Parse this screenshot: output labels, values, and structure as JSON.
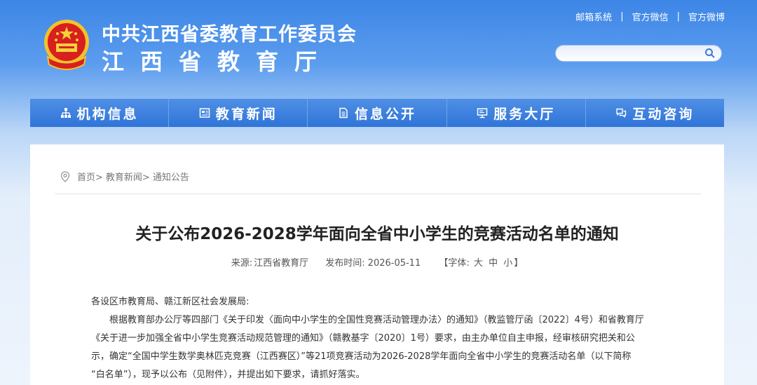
{
  "header": {
    "title_line1": "中共江西省委教育工作委员会",
    "title_line2": "江西省教育厅",
    "top_links": [
      "邮箱系统",
      "官方微信",
      "官方微博"
    ],
    "top_link_separator": "|",
    "search": {
      "placeholder": "",
      "value": ""
    }
  },
  "nav": {
    "items": [
      {
        "label": "机构信息",
        "icon": "org-chart-icon"
      },
      {
        "label": "教育新闻",
        "icon": "news-icon"
      },
      {
        "label": "信息公开",
        "icon": "document-icon"
      },
      {
        "label": "服务大厅",
        "icon": "monitor-icon"
      },
      {
        "label": "互动咨询",
        "icon": "chat-icon"
      }
    ]
  },
  "breadcrumb": {
    "items": [
      "首页>",
      "教育新闻>",
      "通知公告"
    ]
  },
  "article": {
    "title": "关于公布2026-2028学年面向全省中小学生的竞赛活动名单的通知",
    "source_label": "来源:",
    "source": "江西省教育厅",
    "time_label": "发布时间:",
    "time": "2026-05-11",
    "font_size_label": "【字体:",
    "font_sizes": [
      "大",
      "中",
      "小"
    ],
    "font_size_close": "】",
    "salutation": "各设区市教育局、赣江新区社会发展局:",
    "paragraph_lines": [
      "根据教育部办公厅等四部门《关于印发〈面向中小学生的全国性竞赛活动管理办法〉的通知》（教监管厅函〔2022〕4号）和省教育厅",
      "《关于进一步加强全省中小学生竞赛活动规范管理的通知》（赣教基字〔2020〕1号）要求，由主办单位自主申报，经审核研究把关和公",
      "示，确定“全国中学生数学奥林匹克竞赛（江西赛区）”等21项竞赛活动为2026-2028学年面向全省中小学生的竞赛活动名单（以下简称",
      "“白名单”），现予以公布（见附件），并提出如下要求，请抓好落实。"
    ]
  },
  "colors": {
    "nav_bg": "#2f74d8",
    "header_gradient_top": "#3d86e6",
    "panel_bg": "#ffffff",
    "title_text": "#222222"
  }
}
